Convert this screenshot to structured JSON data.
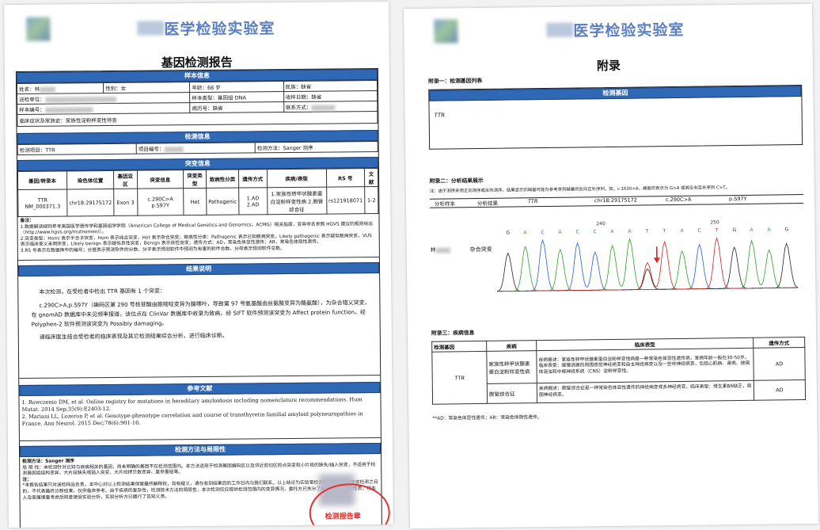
{
  "left": {
    "lab_name": "医学检验实验室",
    "report_title": "基因检测报告",
    "sample_section": "样本信息",
    "sample_rows": [
      [
        "姓名：林",
        "性别：女",
        "年龄：66 岁",
        "民族：缺省"
      ],
      [
        "送检单位：",
        "",
        "样本类型：基因组 DNA",
        "收样日期：缺省"
      ],
      [
        "样本编号：",
        "",
        "病历号：缺省",
        "联系方式："
      ]
    ],
    "clinical": "临床症状及家族史：家族性淀粉样变性待查",
    "detect_section": "检测信息",
    "detect_item": "检测项目：TTR",
    "project_no": "项目编号：",
    "method": "检测方法：Sanger 测序",
    "mutation_section": "突变信息",
    "mutation_headers": [
      "基因/转录本",
      "染色体位置",
      "基因亚区",
      "突变信息",
      "突变类型",
      "致病性分类",
      "遗传方式",
      "疾病/表型",
      "RS 号",
      "文献"
    ],
    "mutation_row": [
      "TTR NM_000371.3",
      "chr18:29175172",
      "Exon 3",
      "c.290C>A p.S97Y",
      "Het",
      "Pathogenic",
      "1.AD 2.AD",
      "1.家族性转甲状腺素蛋白淀粉样变性病 2.腕管综合征",
      "rs121918071",
      "1-2"
    ],
    "notes_title": "备注：",
    "notes": [
      "1.数据解读规则参考美国医学遗传学和基因组学学院（American College of Medical Genetics and Genomics，ACMG）相关指南，变异命名参照 HGVS 建议的规则给出（http://www.hgvs.org/mutnomen/）。",
      "2.突变类型：Hemi 表示半合子突变，Hom 表示纯合突变，Het 表示杂合突变；致病性分类：Pathogenic 表示已知致病突变，Likely pathogenic 表示疑似致病突变，VUS 表示临床意义未明突变，Likely benign 表示疑似良性突变，Benign 表示良性突变；遗传方式：AD，常染色体显性遗传；AR，常染色体隐性遗传。",
      "3.RS 号表示在数据库中的编号；分值表示预测软件的分数，分子表示预测软件中预测为有害的软件总数，分母表示预测软件总数。"
    ],
    "result_section": "结果说明",
    "result_p1": "本次检测，在受检者中检出 TTR 基因有 1 个突变：",
    "result_p2": "c.290C>A,p.S97Y（编码区第 290 号核苷酸由胞嘧啶变异为腺嘌呤，导致第 97 号氨基酸由丝氨酸变异为酪氨酸），为杂合错义突变，在 gnomAD 数据库中未见频率报道，该位点在 ClinVar 数据库中收录为致病，经 SIFT 软件预测该突变为 Affect protein function，经 Polyphen-2 软件预测该突变为 Possibly damaging。",
    "result_p3": "请临床医生结合受检者的临床表现及其它检测结果综合分析，进行临床诊断。",
    "ref_section": "参考文献",
    "refs": [
      "1. Rowczenio DM, et al. Online registry for mutations in hereditary amyloidosis including nomenclature recommendations. Hum Mutat. 2014 Sep;35(9):E2403-12.",
      "2. Mariani LL, Lozeron P, et al. Genotype-phenotype correlation and course of transthyretin familial amyloid polyneuropathies in France. Ann Neurol. 2015 Dec;78(6):901-16."
    ],
    "limit_section": "检测方法与局限性",
    "limit_method": "检测方法：Sanger 测序",
    "limit_text": "局 限 性：本检测针对已知与疾病相关的基因，尚未明确的基因不在检测范围内。本方法适用于检测基因编码区以及邻近剪切区的点突变和小片段的缺失/插入突变，不适用于检测基因组结构变异、大片段缺失或插入突变、大片段拷贝数变异、复杂重组等。",
    "note_label": "注：",
    "note_text": "*本报告结果只对送检样品负责。本中心对以上检测结果保留最终解释权，如有疑义，请在收到结果后的工作日内与我们联系。以上结论为实验室检测数据，仅用于突变检测之目的，不代表最终诊断结果，仅供临床参考。由于疾病的复杂性，检测技术方法的局限性，本次检测仅仅提供检测范围内的变异情况，委托方已充分了解该诊断研究的性质，经本人及家属慎重考虑后同意接受实验分析，实验分析方已履行了告知义务。",
    "stamp_text": "检测报告章"
  },
  "right": {
    "lab_name": "医学检验实验室",
    "title": "附录",
    "app1_title": "附录一：检测基因列表",
    "app1_header": "检测基因",
    "app1_gene": "TTR",
    "app2_title": "附录二：分析结果展示",
    "app2_note": "注：由于测序采用正向测序或反向测序，结果显示的碱基可能为参考序列碱基的反向互补序列，如，c.1630>A，峰图可表示为 G>A 或其反向互补序列 C>T。",
    "app2_headers": [
      "分析样本",
      "分析结果",
      "TTR",
      "chr18:29175172",
      "c.290C>A",
      "p.S97Y"
    ],
    "axis_labels": [
      "240",
      "250"
    ],
    "bases": [
      "G",
      "A",
      "C",
      "A",
      "C",
      "C",
      "A",
      "A",
      "T",
      "T",
      "A",
      "C",
      "T",
      "G",
      "A",
      "A",
      "G"
    ],
    "sample_name": "林",
    "sample_result": "杂合突变",
    "app3_title": "附录三：疾病信息",
    "app3_headers": [
      "检测基因",
      "疾病",
      "临床表型",
      "遗传方式"
    ],
    "app3_gene": "TTR",
    "app3_rows": [
      {
        "disease": "家族性转甲状腺素蛋白淀粉样变性病",
        "phenotype": "疾病概述：家族性转甲状腺素蛋白淀粉样变性病是一种常染色体显性遗传病，发病年龄一般在30-50岁。临床表型：缓慢进展的周围感觉神经病变和自主神经病变以及一些非神经病变，包括心肌病、肾病、玻璃体混浊和中枢神经系统（CNS）淀粉样变性。",
        "mode": "AD"
      },
      {
        "disease": "腕管综合征",
        "phenotype": "疾病概述：腕管综合征是一种常染色体显性遗传的神经病变或多神经病变。临床表型：维生素B6缺乏，周围神经病变。",
        "mode": "AD"
      }
    ],
    "footnote": "**AD：常染色体显性遗传；AR：常染色体隐性遗传。"
  }
}
